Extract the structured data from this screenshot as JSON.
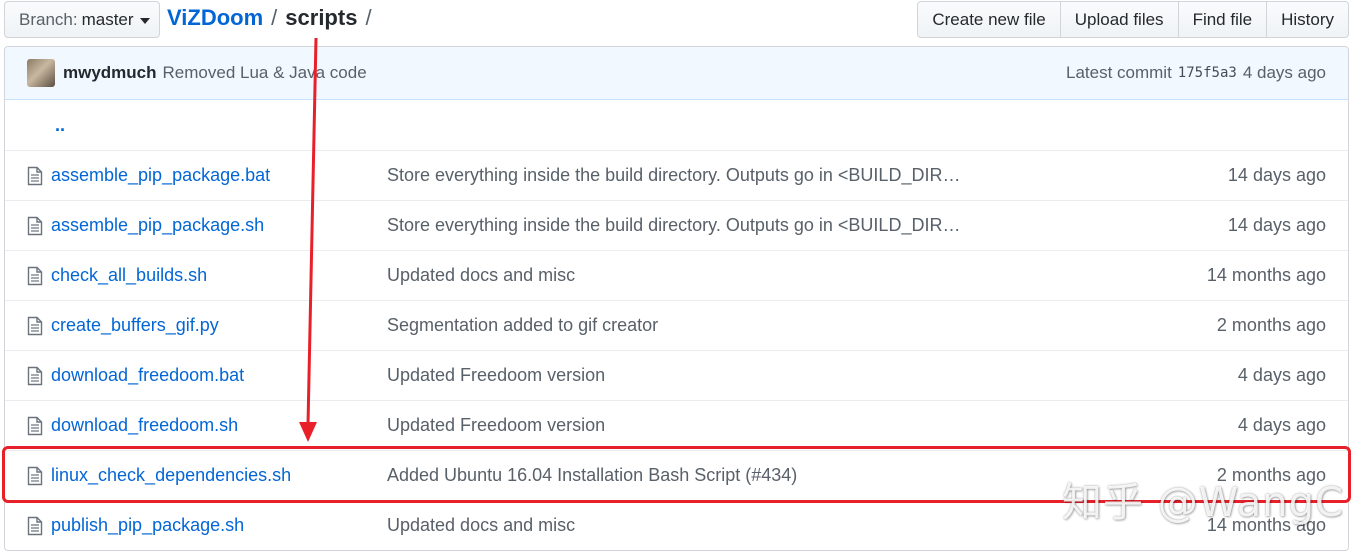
{
  "branch": {
    "label": "Branch:",
    "value": "master"
  },
  "breadcrumb": {
    "repo": "ViZDoom",
    "sep1": "/",
    "dir": "scripts",
    "sep2": "/"
  },
  "actions": {
    "create_new_file": "Create new file",
    "upload_files": "Upload files",
    "find_file": "Find file",
    "history": "History"
  },
  "latest_commit": {
    "author": "mwydmuch",
    "message": "Removed Lua & Java code",
    "prefix": "Latest commit",
    "sha": "175f5a3",
    "age": "4 days ago"
  },
  "parent_dir": "..",
  "files": [
    {
      "name": "assemble_pip_package.bat",
      "message": "Store everything inside the build directory. Outputs go in <BUILD_DIR…",
      "age": "14 days ago"
    },
    {
      "name": "assemble_pip_package.sh",
      "message": "Store everything inside the build directory. Outputs go in <BUILD_DIR…",
      "age": "14 days ago"
    },
    {
      "name": "check_all_builds.sh",
      "message": "Updated docs and misc",
      "age": "14 months ago"
    },
    {
      "name": "create_buffers_gif.py",
      "message": "Segmentation added to gif creator",
      "age": "2 months ago"
    },
    {
      "name": "download_freedoom.bat",
      "message": "Updated Freedoom version",
      "age": "4 days ago"
    },
    {
      "name": "download_freedoom.sh",
      "message": "Updated Freedoom version",
      "age": "4 days ago"
    },
    {
      "name": "linux_check_dependencies.sh",
      "message": "Added Ubuntu 16.04 Installation Bash Script (#434)",
      "age": "2 months ago"
    },
    {
      "name": "publish_pip_package.sh",
      "message": "Updated docs and misc",
      "age": "14 months ago"
    }
  ],
  "annotation": {
    "color": "#e8202a"
  },
  "watermark": "知乎 @WangC",
  "colors": {
    "link": "#0366d6",
    "muted": "#586069",
    "commit_bg": "#f1f8ff"
  }
}
